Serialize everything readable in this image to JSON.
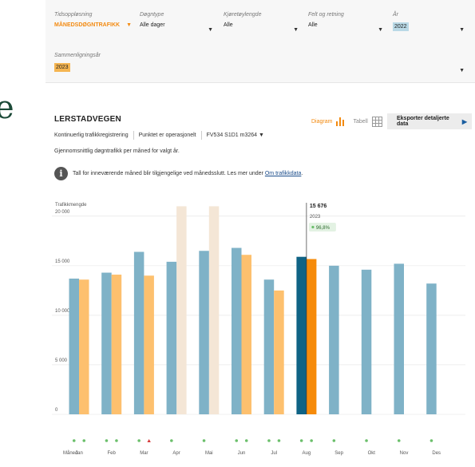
{
  "brand_glyph": "e",
  "filters": [
    {
      "label": "Tidsoppløsning",
      "value": "MÅNEDSDØGNTRAFIKK"
    },
    {
      "label": "Døgntype",
      "value": "Alle dager"
    },
    {
      "label": "Kjøretøylengde",
      "value": "Alle"
    },
    {
      "label": "Felt og retning",
      "value": "Alle"
    },
    {
      "label": "År",
      "value": "2022"
    },
    {
      "label": "Sammenligningsår",
      "value": "2023"
    }
  ],
  "station": {
    "name": "LERSTADVEGEN",
    "type": "Kontinuerlig trafikkregistrering",
    "status": "Punktet er operasjonelt",
    "road_ref": "FV534 S1D1 m3264",
    "description": "Gjennomsnittlig døgntrafikk per måned for valgt år.",
    "info_text": "Tall for inneværende måned blir tilgjengelige ved månedsslutt. Les mer under ",
    "info_link": "Om trafikkdata",
    "info_end": "."
  },
  "view": {
    "diagram": "Diagram",
    "tabell": "Tabell",
    "export": "Eksporter detaljerte data"
  },
  "tooltip": {
    "value": "15 676",
    "year": "2023",
    "change": "96,8%"
  },
  "colors": {
    "bar_2022": "#7fb2c7",
    "bar_2023": "#fdc06e",
    "bar_2022_active": "#0f6385",
    "bar_2023_active": "#f68b0a",
    "bar_placeholder": "#f4e6d6",
    "dot_green": "#6bbf6b",
    "dot_red": "#d63a3a",
    "grid": "#e2e2e2"
  },
  "chart_data": {
    "type": "bar",
    "ylabel": "Trafikkmengde",
    "ylim": [
      0,
      22000
    ],
    "yticks": [
      0,
      5000,
      10000,
      15000,
      20000
    ],
    "ytick_labels": [
      "0",
      "5 000",
      "10 000",
      "15 000",
      "20 000"
    ],
    "xlabel": "Måned",
    "categories": [
      "Jan",
      "Feb",
      "Mar",
      "Apr",
      "Mai",
      "Jun",
      "Jul",
      "Aug",
      "Sep",
      "Okt",
      "Nov",
      "Des"
    ],
    "series": [
      {
        "name": "2022",
        "values": [
          13700,
          14300,
          16400,
          15400,
          16500,
          16800,
          13600,
          15900,
          15000,
          14600,
          15200,
          13200
        ]
      },
      {
        "name": "2023",
        "values": [
          13600,
          14100,
          14000,
          null,
          null,
          16100,
          12500,
          15676,
          null,
          null,
          null,
          null
        ]
      }
    ],
    "placeholder_months": [
      "Apr",
      "Mai"
    ],
    "placeholder_value": 21000,
    "highlighted_month": "Aug",
    "status_dots_2022": [
      "green",
      "green",
      "green",
      "green",
      "green",
      "green",
      "green",
      "green",
      "green",
      "green",
      "green",
      "green"
    ],
    "status_dots_2023": [
      "green",
      "green",
      "red",
      null,
      null,
      "green",
      "green",
      "green",
      null,
      null,
      null,
      null
    ]
  }
}
